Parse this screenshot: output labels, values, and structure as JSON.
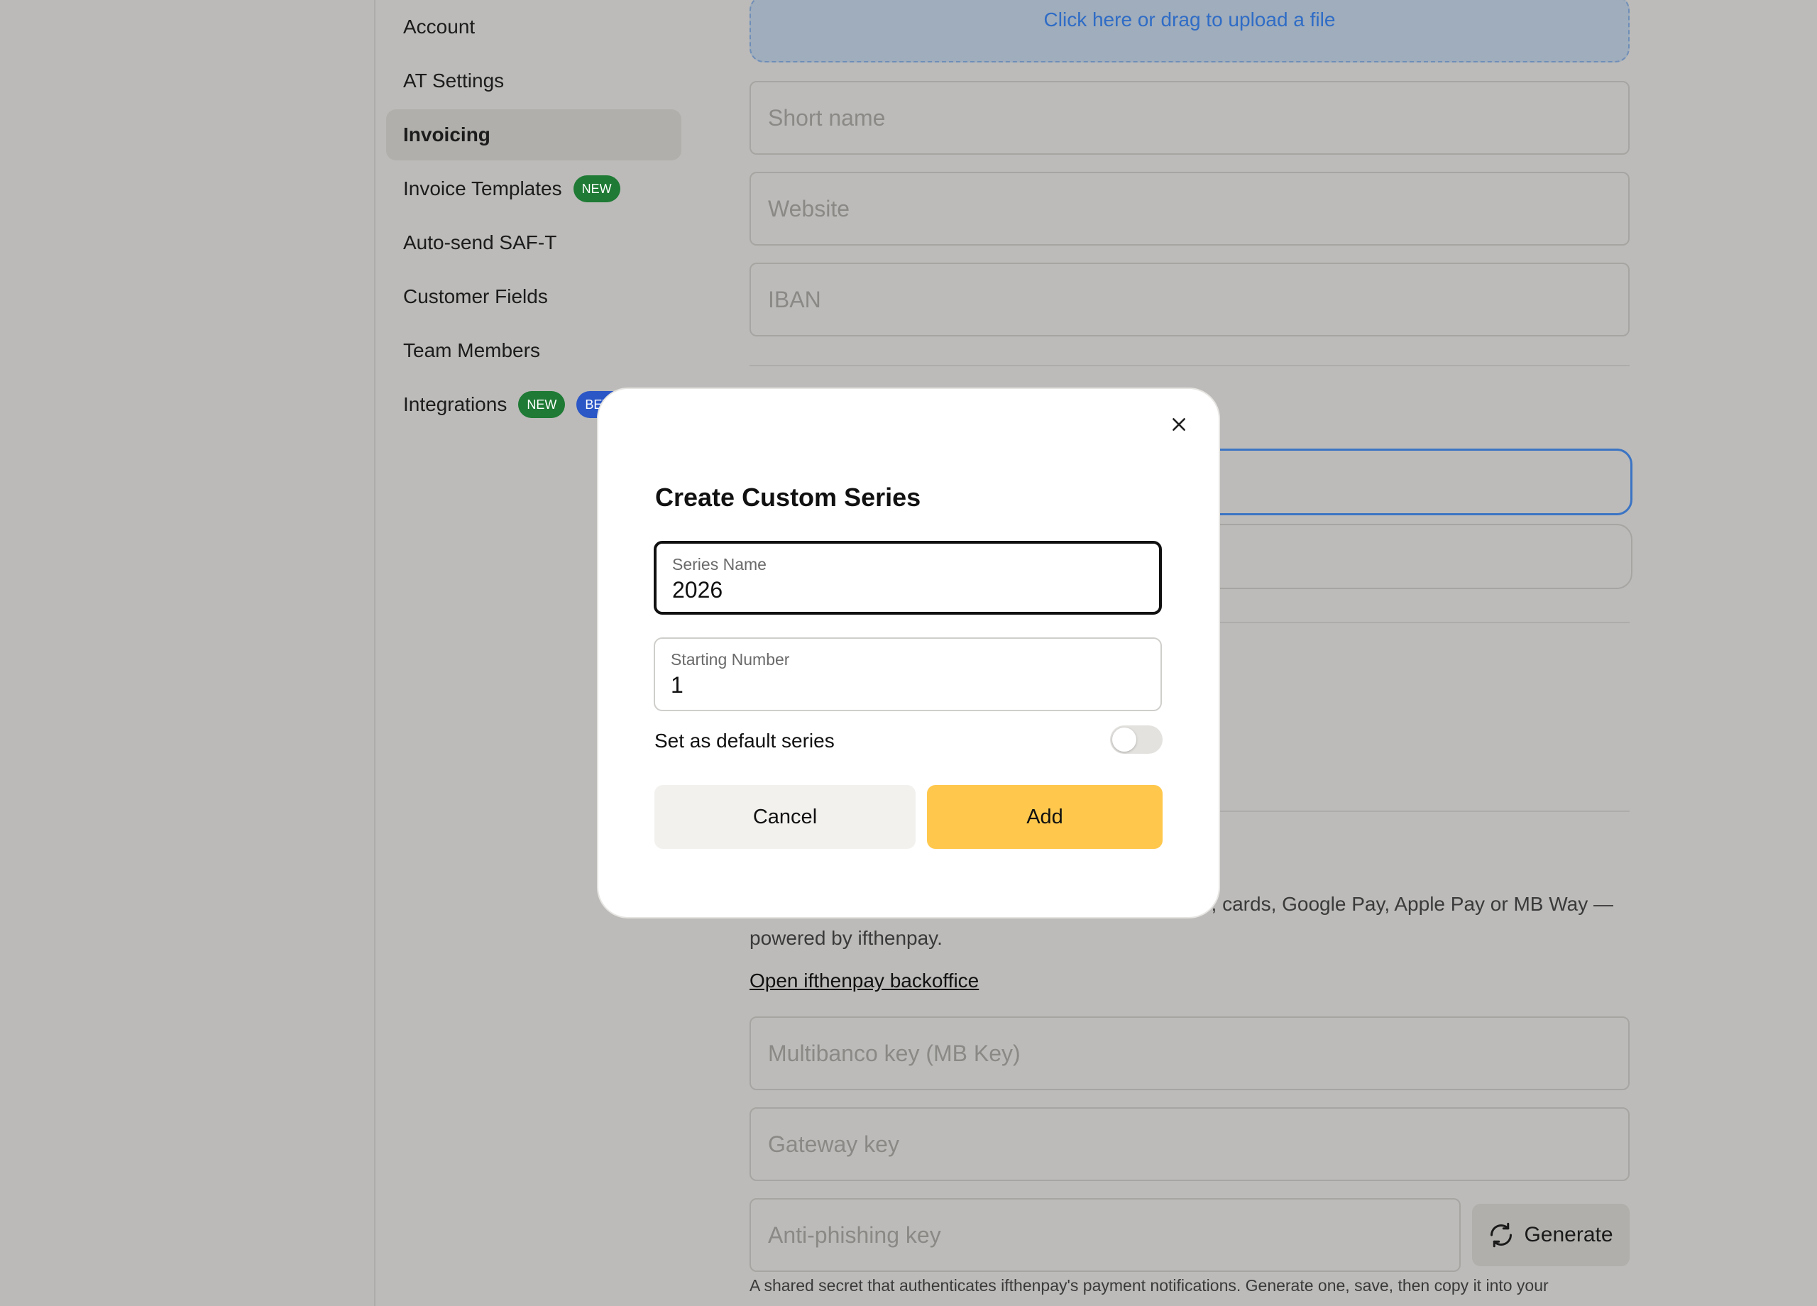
{
  "sidebar": {
    "items": [
      {
        "label": "Account"
      },
      {
        "label": "AT Settings"
      },
      {
        "label": "Invoicing",
        "active": true
      },
      {
        "label": "Invoice Templates",
        "badge": "NEW"
      },
      {
        "label": "Auto-send SAF-T"
      },
      {
        "label": "Customer Fields"
      },
      {
        "label": "Team Members"
      },
      {
        "label": "Integrations",
        "badge": "NEW",
        "badge2": "BETA"
      }
    ]
  },
  "main": {
    "upload_text": "Click here or drag to upload a file",
    "short_name_placeholder": "Short name",
    "website_placeholder": "Website",
    "iban_placeholder": "IBAN",
    "payments_description": "Let customers pay invoices via Multibanco reference, cards, Google Pay, Apple Pay or MB Way — powered by ifthenpay.",
    "backoffice_link": "Open ifthenpay backoffice",
    "multibanco_placeholder": "Multibanco key (MB Key)",
    "gateway_placeholder": "Gateway key",
    "antiphishing_placeholder": "Anti-phishing key",
    "generate_label": "Generate",
    "helper_text": "A shared secret that authenticates ifthenpay's payment notifications. Generate one, save, then copy it into your"
  },
  "modal": {
    "title": "Create Custom Series",
    "series_name_label": "Series Name",
    "series_name_value": "2026",
    "starting_number_label": "Starting Number",
    "starting_number_value": "1",
    "default_toggle_label": "Set as default series",
    "default_toggle_on": false,
    "cancel_label": "Cancel",
    "add_label": "Add"
  },
  "colors": {
    "accent_yellow": "#ffc84d",
    "badge_green": "#1e7a34",
    "badge_blue": "#2a56c6",
    "link_blue": "#2f6cc6"
  }
}
